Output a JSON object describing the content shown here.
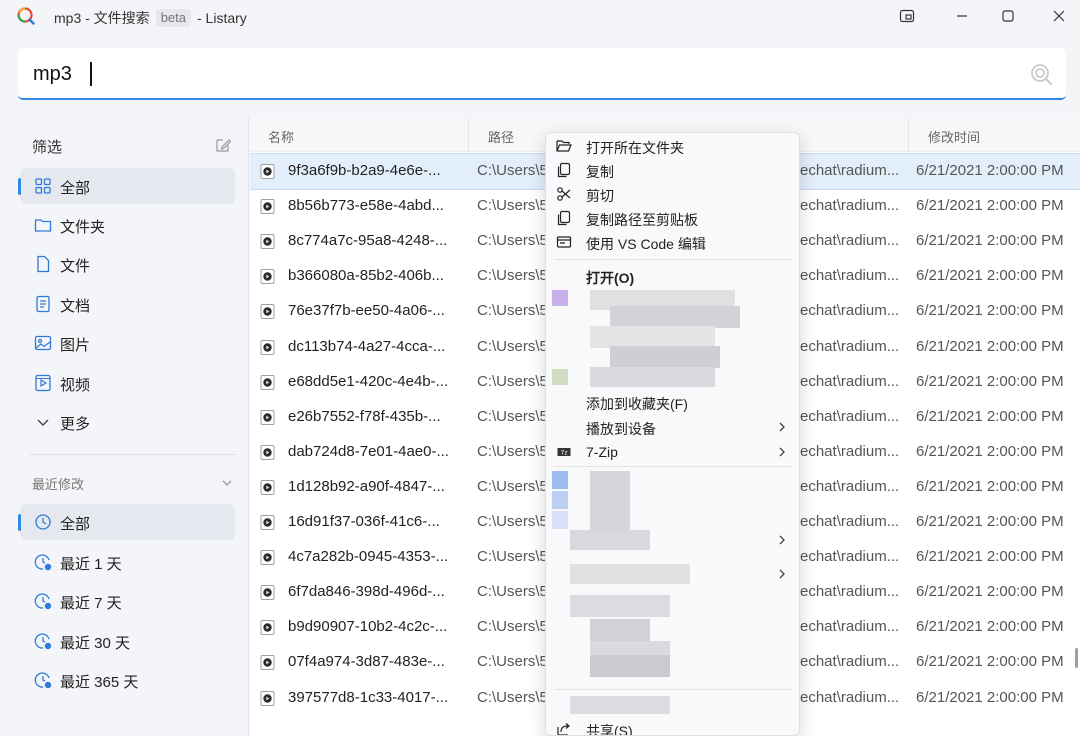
{
  "window": {
    "title_prefix": "mp3 - 文件搜索",
    "beta_badge": "beta",
    "title_suffix": "- Listary"
  },
  "search": {
    "query": "mp3"
  },
  "sidebar": {
    "filter_heading": "筛选",
    "filters": [
      {
        "label": "全部",
        "icon": "grid-icon",
        "active": true
      },
      {
        "label": "文件夹",
        "icon": "folder-icon",
        "active": false
      },
      {
        "label": "文件",
        "icon": "file-icon",
        "active": false
      },
      {
        "label": "文档",
        "icon": "document-icon",
        "active": false
      },
      {
        "label": "图片",
        "icon": "image-icon",
        "active": false
      },
      {
        "label": "视频",
        "icon": "video-icon",
        "active": false
      },
      {
        "label": "更多",
        "icon": "chevron-down-icon",
        "active": false
      }
    ],
    "recent_heading": "最近修改",
    "recent": [
      {
        "label": "全部",
        "icon": "clock-icon",
        "active": true
      },
      {
        "label": "最近 1 天",
        "icon": "clock-1d-icon",
        "active": false
      },
      {
        "label": "最近 7 天",
        "icon": "clock-7d-icon",
        "active": false
      },
      {
        "label": "最近 30 天",
        "icon": "clock-1m-icon",
        "active": false
      },
      {
        "label": "最近 365 天",
        "icon": "clock-1y-icon",
        "active": false
      }
    ]
  },
  "table": {
    "headers": {
      "name": "名称",
      "path": "路径",
      "modified": "修改时间"
    },
    "rows": [
      {
        "name": "9f3a6f9b-b2a9-4e6e-...",
        "path_start": "C:\\Users\\5",
        "path_end": "echat\\radium...",
        "modified": "6/21/2021 2:00:00 PM",
        "selected": true
      },
      {
        "name": "8b56b773-e58e-4abd...",
        "path_start": "C:\\Users\\5",
        "path_end": "echat\\radium...",
        "modified": "6/21/2021 2:00:00 PM"
      },
      {
        "name": "8c774a7c-95a8-4248-...",
        "path_start": "C:\\Users\\5",
        "path_end": "echat\\radium...",
        "modified": "6/21/2021 2:00:00 PM"
      },
      {
        "name": "b366080a-85b2-406b...",
        "path_start": "C:\\Users\\5",
        "path_end": "echat\\radium...",
        "modified": "6/21/2021 2:00:00 PM"
      },
      {
        "name": "76e37f7b-ee50-4a06-...",
        "path_start": "C:\\Users\\5",
        "path_end": "echat\\radium...",
        "modified": "6/21/2021 2:00:00 PM"
      },
      {
        "name": "dc113b74-4a27-4cca-...",
        "path_start": "C:\\Users\\5",
        "path_end": "echat\\radium...",
        "modified": "6/21/2021 2:00:00 PM"
      },
      {
        "name": "e68dd5e1-420c-4e4b-...",
        "path_start": "C:\\Users\\5",
        "path_end": "echat\\radium...",
        "modified": "6/21/2021 2:00:00 PM"
      },
      {
        "name": "e26b7552-f78f-435b-...",
        "path_start": "C:\\Users\\5",
        "path_end": "echat\\radium...",
        "modified": "6/21/2021 2:00:00 PM"
      },
      {
        "name": "dab724d8-7e01-4ae0-...",
        "path_start": "C:\\Users\\5",
        "path_end": "echat\\radium...",
        "modified": "6/21/2021 2:00:00 PM"
      },
      {
        "name": "1d128b92-a90f-4847-...",
        "path_start": "C:\\Users\\5",
        "path_end": "echat\\radium...",
        "modified": "6/21/2021 2:00:00 PM"
      },
      {
        "name": "16d91f37-036f-41c6-...",
        "path_start": "C:\\Users\\5",
        "path_end": "echat\\radium...",
        "modified": "6/21/2021 2:00:00 PM"
      },
      {
        "name": "4c7a282b-0945-4353-...",
        "path_start": "C:\\Users\\5",
        "path_end": "echat\\radium...",
        "modified": "6/21/2021 2:00:00 PM"
      },
      {
        "name": "6f7da846-398d-496d-...",
        "path_start": "C:\\Users\\5",
        "path_end": "echat\\radium...",
        "modified": "6/21/2021 2:00:00 PM"
      },
      {
        "name": "b9d90907-10b2-4c2c-...",
        "path_start": "C:\\Users\\5",
        "path_end": "echat\\radium...",
        "modified": "6/21/2021 2:00:00 PM"
      },
      {
        "name": "07f4a974-3d87-483e-...",
        "path_start": "C:\\Users\\5",
        "path_end": "echat\\radium...",
        "modified": "6/21/2021 2:00:00 PM"
      },
      {
        "name": "397577d8-1c33-4017-...",
        "path_start": "C:\\Users\\5",
        "path_end": "echat\\radium...",
        "modified": "6/21/2021 2:00:00 PM"
      }
    ]
  },
  "context_menu": {
    "top_items": [
      {
        "label": "打开所在文件夹",
        "icon": "folder-open-icon"
      },
      {
        "label": "复制",
        "icon": "copy-icon"
      },
      {
        "label": "剪切",
        "icon": "scissors-icon"
      },
      {
        "label": "复制路径至剪贴板",
        "icon": "copy-path-icon"
      },
      {
        "label": "使用 VS Code 编辑",
        "icon": "vscode-icon"
      }
    ],
    "open_label": "打开(O)",
    "favorite_label": "添加到收藏夹(F)",
    "cast_label": "播放到设备",
    "zip_label": "7-Zip",
    "share_label": "共享(S)"
  }
}
